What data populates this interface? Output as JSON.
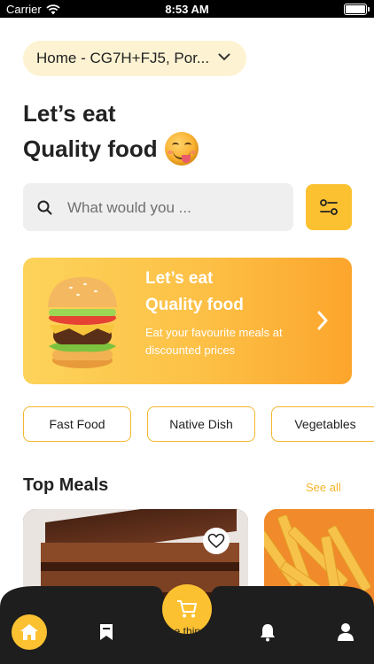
{
  "status_bar": {
    "carrier": "Carrier",
    "time": "8:53 AM"
  },
  "location": {
    "label": "Home - CG7H+FJ5, Por..."
  },
  "greeting": {
    "line1": "Let’s eat",
    "line2": "Quality food"
  },
  "search": {
    "placeholder": "What would you ..."
  },
  "banner": {
    "title_line1": "Let’s eat",
    "title_line2": "Quality food",
    "subtitle": "Eat your favourite meals at discounted prices"
  },
  "categories": [
    "Fast Food",
    "Native Dish",
    "Vegetables"
  ],
  "top_meals": {
    "title": "Top Meals",
    "see_all": "See all"
  },
  "bottom_nav": {
    "cart_label": "be thin"
  },
  "colors": {
    "accent": "#fcc131",
    "pill_bg": "#fdf3d2",
    "nav_bg": "#1e1e1e"
  },
  "icons": [
    "wifi-icon",
    "chevron-down-icon",
    "search-icon",
    "filter-icon",
    "chevron-right-icon",
    "heart-icon",
    "home-icon",
    "bookmark-icon",
    "cart-icon",
    "bell-icon",
    "profile-icon"
  ]
}
